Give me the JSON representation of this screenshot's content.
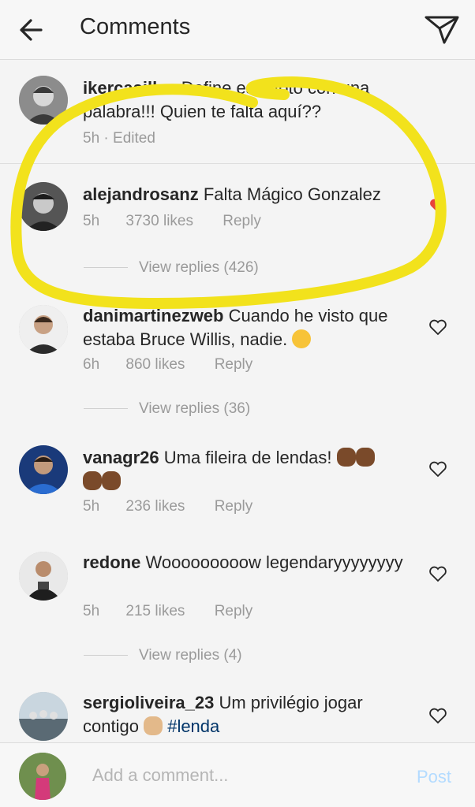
{
  "header": {
    "title": "Comments",
    "back_icon": "arrow-left-icon",
    "share_icon": "paper-plane-icon"
  },
  "comments": [
    {
      "username": "ikercasillas",
      "text": "Define esta foto con una palabra!!! Quien te falta aquí??",
      "time": "5h",
      "edited": "· Edited"
    },
    {
      "username": "alejandrosanz",
      "text": "Falta Mágico Gonzalez",
      "time": "5h",
      "likes": "3730 likes",
      "reply": "Reply",
      "view_replies": "View replies (426)"
    },
    {
      "username": "danimartinezweb",
      "text": "Cuando he visto que estaba Bruce Willis, nadie.",
      "time": "6h",
      "likes": "860 likes",
      "reply": "Reply",
      "view_replies": "View replies (36)"
    },
    {
      "username": "vanagr26",
      "text": "Uma fileira de lendas!",
      "time": "5h",
      "likes": "236 likes",
      "reply": "Reply"
    },
    {
      "username": "redone",
      "text": "Wooooooooow legendaryyyyyyyy",
      "time": "5h",
      "likes": "215 likes",
      "reply": "Reply",
      "view_replies": "View replies (4)"
    },
    {
      "username": "sergioliveira_23",
      "text": "Um privilégio jogar contigo",
      "hashtag": "#lenda"
    }
  ],
  "composer": {
    "placeholder": "Add a comment...",
    "post_label": "Post"
  },
  "colors": {
    "highlight": "#f2e21c",
    "link": "#003569",
    "post_disabled": "#b3dbff"
  }
}
